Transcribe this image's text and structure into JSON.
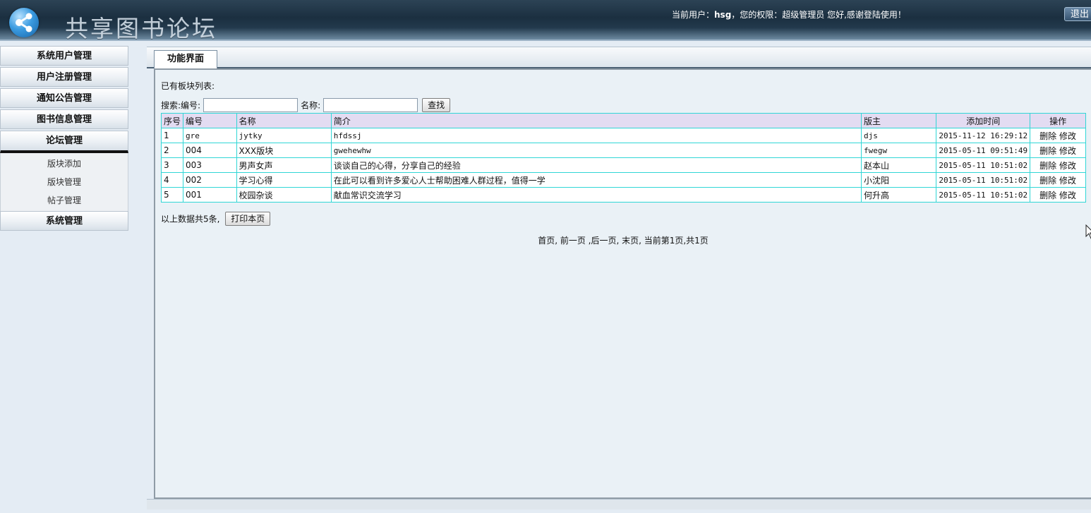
{
  "header": {
    "site_title": "共享图书论坛",
    "user_prefix": "当前用户：",
    "username": "hsg",
    "permission_text": "，您的权限：超级管理员 您好,感谢登陆使用！",
    "logout_label": "退出"
  },
  "sidebar": {
    "items": [
      {
        "label": "系统用户管理"
      },
      {
        "label": "用户注册管理"
      },
      {
        "label": "通知公告管理"
      },
      {
        "label": "图书信息管理"
      },
      {
        "label": "论坛管理"
      },
      {
        "label": "系统管理"
      }
    ],
    "submenu": [
      "版块添加",
      "版块管理",
      "帖子管理"
    ]
  },
  "tab": {
    "label": "功能界面"
  },
  "main": {
    "list_title": "已有板块列表:",
    "search_label_no": "搜索:编号:",
    "search_label_name": "名称:",
    "search_no_value": "",
    "search_name_value": "",
    "search_button": "查找",
    "columns": [
      "序号",
      "编号",
      "名称",
      "简介",
      "版主",
      "添加时间",
      "操作"
    ],
    "rows": [
      {
        "seq": "1",
        "code": "gre",
        "name": "jytky",
        "intro": "hfdssj",
        "moderator": "djs",
        "time": "2015-11-12 16:29:12"
      },
      {
        "seq": "2",
        "code": "004",
        "name": "XXX版块",
        "intro": "gwehewhw",
        "moderator": "fwegw",
        "time": "2015-05-11 09:51:49"
      },
      {
        "seq": "3",
        "code": "003",
        "name": "男声女声",
        "intro": "谈谈自己的心得，分享自己的经验",
        "moderator": "赵本山",
        "time": "2015-05-11 10:51:02"
      },
      {
        "seq": "4",
        "code": "002",
        "name": "学习心得",
        "intro": "在此可以看到许多爱心人士帮助困难人群过程，值得一学",
        "moderator": "小沈阳",
        "time": "2015-05-11 10:51:02"
      },
      {
        "seq": "5",
        "code": "001",
        "name": "校园杂谈",
        "intro": "献血常识交流学习",
        "moderator": "何升高",
        "time": "2015-05-11 10:51:02"
      }
    ],
    "delete_label": "删除",
    "edit_label": "修改",
    "summary_text": "以上数据共5条,",
    "print_button": "打印本页",
    "pagination": "首页, 前一页 ,后一页, 末页, 当前第1页,共1页"
  }
}
